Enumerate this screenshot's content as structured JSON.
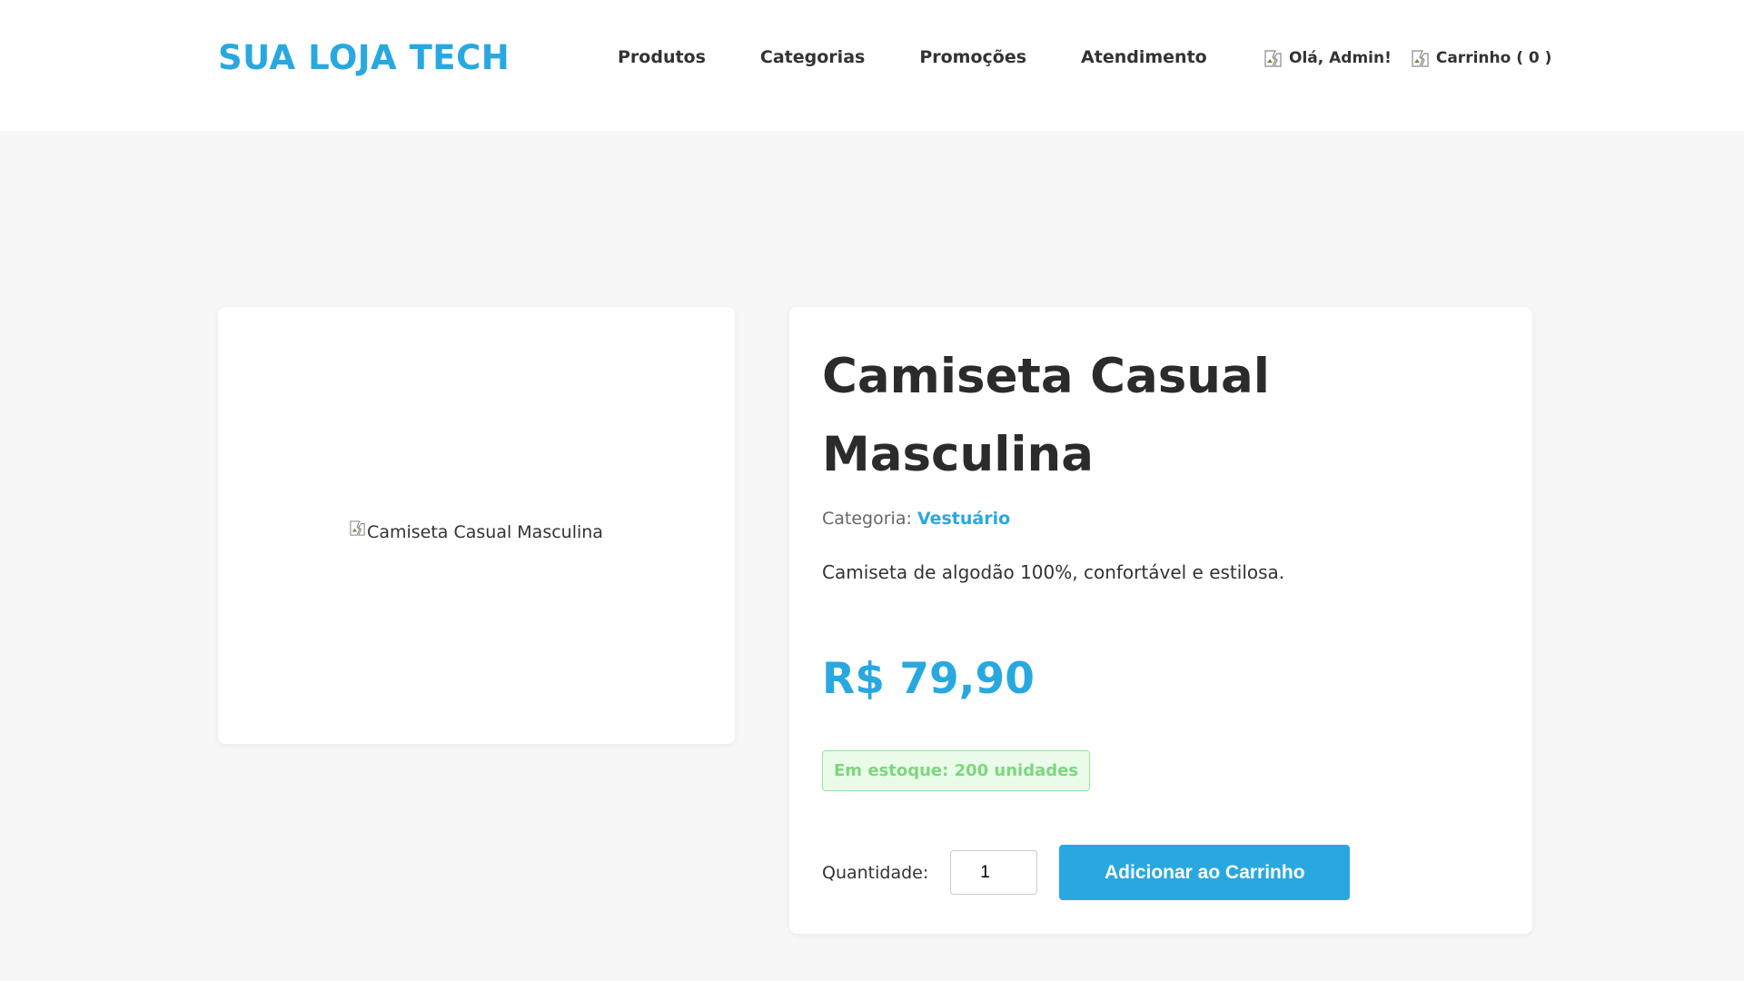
{
  "header": {
    "logo": "SUA LOJA TECH",
    "nav": [
      {
        "label": "Produtos"
      },
      {
        "label": "Categorias"
      },
      {
        "label": "Promoções"
      },
      {
        "label": "Atendimento"
      }
    ],
    "user_greeting": "Olá, Admin!",
    "cart_label": "Carrinho ( 0 )"
  },
  "product": {
    "image_alt": "Camiseta Casual Masculina",
    "title": "Camiseta Casual Masculina",
    "category_label": "Categoria:",
    "category_value": "Vestuário",
    "description": "Camiseta de algodão 100%, confortável e estilosa.",
    "price": "R$ 79,90",
    "stock": "Em estoque: 200 unidades",
    "quantity_label": "Quantidade:",
    "quantity_value": "1",
    "add_button": "Adicionar ao Carrinho"
  },
  "colors": {
    "accent": "#29a8e0",
    "stock_text": "#7ed67e",
    "stock_bg": "#eafbea",
    "page_bg": "#f7f7f7"
  },
  "icons": {
    "user": "broken-image-icon",
    "cart": "broken-image-icon"
  }
}
